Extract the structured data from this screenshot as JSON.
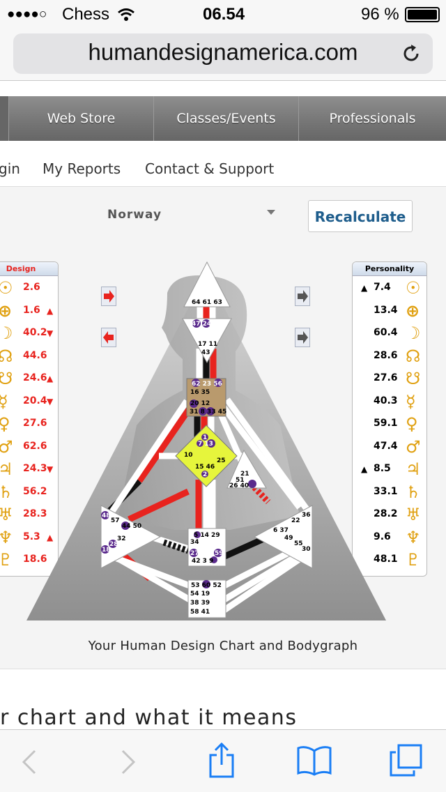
{
  "status": {
    "signal": "●●●●○",
    "carrier": "Chess",
    "time": "06.54",
    "battery": "96 %"
  },
  "browser": {
    "url": "humandesignamerica.com"
  },
  "nav": {
    "items": [
      "Web Store",
      "Classes/Events",
      "Professionals"
    ]
  },
  "subnav": {
    "items": [
      "gin",
      "My Reports",
      "Contact & Support"
    ]
  },
  "form": {
    "country": "Norway",
    "recalculate": "Recalculate"
  },
  "design": {
    "title": "Design",
    "rows": [
      {
        "glyph": "☉",
        "value": "2.6",
        "mark": ""
      },
      {
        "glyph": "⊕",
        "value": "1.6",
        "mark": "▲"
      },
      {
        "glyph": "☽",
        "value": "40.2",
        "mark": "▼"
      },
      {
        "glyph": "☊",
        "value": "44.6",
        "mark": ""
      },
      {
        "glyph": "☋",
        "value": "24.6",
        "mark": "▲"
      },
      {
        "glyph": "☿",
        "value": "20.4",
        "mark": "▼"
      },
      {
        "glyph": "♀",
        "value": "27.6",
        "mark": ""
      },
      {
        "glyph": "♂",
        "value": "62.6",
        "mark": ""
      },
      {
        "glyph": "♃",
        "value": "24.3",
        "mark": "▼"
      },
      {
        "glyph": "♄",
        "value": "56.2",
        "mark": ""
      },
      {
        "glyph": "♅",
        "value": "28.3",
        "mark": ""
      },
      {
        "glyph": "♆",
        "value": "5.3",
        "mark": "▲"
      },
      {
        "glyph": "♇",
        "value": "18.6",
        "mark": ""
      }
    ]
  },
  "personality": {
    "title": "Personality",
    "rows": [
      {
        "glyph": "☉",
        "value": "7.4",
        "mark": "▲"
      },
      {
        "glyph": "⊕",
        "value": "13.4",
        "mark": ""
      },
      {
        "glyph": "☽",
        "value": "60.4",
        "mark": ""
      },
      {
        "glyph": "☊",
        "value": "28.6",
        "mark": ""
      },
      {
        "glyph": "☋",
        "value": "27.6",
        "mark": ""
      },
      {
        "glyph": "☿",
        "value": "40.3",
        "mark": ""
      },
      {
        "glyph": "♀",
        "value": "59.1",
        "mark": ""
      },
      {
        "glyph": "♂",
        "value": "47.4",
        "mark": ""
      },
      {
        "glyph": "♃",
        "value": "8.5",
        "mark": "▲"
      },
      {
        "glyph": "♄",
        "value": "33.1",
        "mark": ""
      },
      {
        "glyph": "♅",
        "value": "28.2",
        "mark": ""
      },
      {
        "glyph": "♆",
        "value": "9.6",
        "mark": ""
      },
      {
        "glyph": "♇",
        "value": "48.1",
        "mark": ""
      }
    ]
  },
  "gates": {
    "head": "64 61 63",
    "ajna_top": "47 24 4",
    "ajna_bottom": "17 11",
    "ajna_43": "43",
    "throat_a": "62 23 56",
    "throat_b": "16 35",
    "throat_c": "20 12",
    "throat_d": "31 8 33 45",
    "g_top": "1",
    "g_b": "7 13",
    "g_10": "10",
    "g_25": "25",
    "g_c": "15 46",
    "g_2": "2",
    "ego": "21",
    "ego_b": "51",
    "ego_c": "26 40",
    "spleen_a": "48",
    "spleen_b": "57",
    "spleen_c": "44 50",
    "spleen_d": "32",
    "spleen_e": "28",
    "spleen_f": "18",
    "sacral_a": "5 14 29",
    "sacral_b": "34",
    "sacral_c": "27",
    "sacral_d": "59",
    "sacral_e": "42 3 9",
    "solar_a": "36",
    "solar_b": "22",
    "solar_c": "6 37",
    "solar_d": "49",
    "solar_e": "55",
    "solar_f": "30",
    "root_a": "53 60 52",
    "root_b": "54 19",
    "root_c": "38 39",
    "root_d": "58 41"
  },
  "caption": "Your Human Design Chart and Bodygraph",
  "section_heading": "r chart and what it means",
  "colors": {
    "defined": "#e8231e",
    "unconscious": "#e8231e",
    "conscious": "#111111",
    "g_center": "#e6f53c",
    "throat": "#b99a6d",
    "accent": "#1e5d8c"
  }
}
